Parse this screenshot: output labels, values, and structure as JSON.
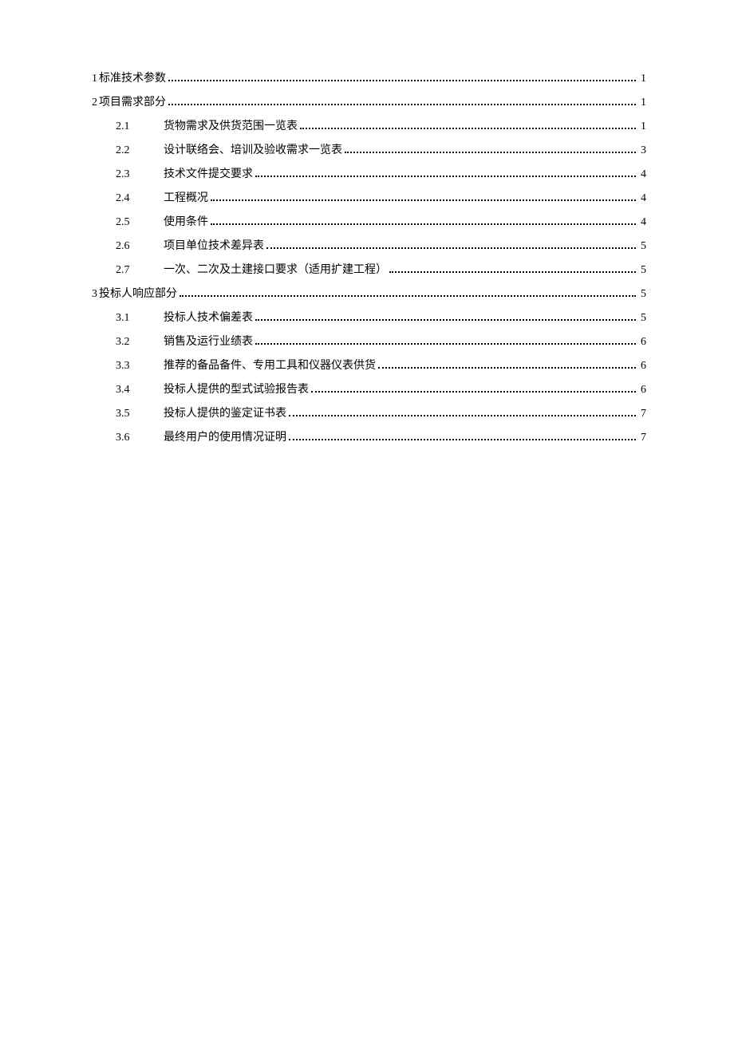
{
  "toc": [
    {
      "level": 1,
      "num": "1",
      "title": "标准技术参数",
      "page": "1"
    },
    {
      "level": 1,
      "num": "2",
      "title": "项目需求部分",
      "page": "1"
    },
    {
      "level": 2,
      "num": "2.1",
      "title": "货物需求及供货范围一览表",
      "page": "1"
    },
    {
      "level": 2,
      "num": "2.2",
      "title": "设计联络会、培训及验收需求一览表",
      "page": "3"
    },
    {
      "level": 2,
      "num": "2.3",
      "title": "技术文件提交要求",
      "page": "4"
    },
    {
      "level": 2,
      "num": "2.4",
      "title": "工程概况",
      "page": "4"
    },
    {
      "level": 2,
      "num": "2.5",
      "title": "使用条件",
      "page": "4"
    },
    {
      "level": 2,
      "num": "2.6",
      "title": "项目单位技术差异表",
      "page": "5"
    },
    {
      "level": 2,
      "num": "2.7",
      "title": "一次、二次及土建接口要求（适用扩建工程）",
      "page": "5"
    },
    {
      "level": 1,
      "num": "3",
      "title": "投标人响应部分",
      "page": "5"
    },
    {
      "level": 2,
      "num": "3.1",
      "title": "投标人技术偏差表",
      "page": "5"
    },
    {
      "level": 2,
      "num": "3.2",
      "title": "销售及运行业绩表",
      "page": "6"
    },
    {
      "level": 2,
      "num": "3.3",
      "title": "推荐的备品备件、专用工具和仪器仪表供货",
      "page": "6"
    },
    {
      "level": 2,
      "num": "3.4",
      "title": "投标人提供的型式试验报告表",
      "page": "6"
    },
    {
      "level": 2,
      "num": "3.5",
      "title": "投标人提供的鉴定证书表",
      "page": "7"
    },
    {
      "level": 2,
      "num": "3.6",
      "title": "最终用户的使用情况证明",
      "page": "7"
    }
  ]
}
